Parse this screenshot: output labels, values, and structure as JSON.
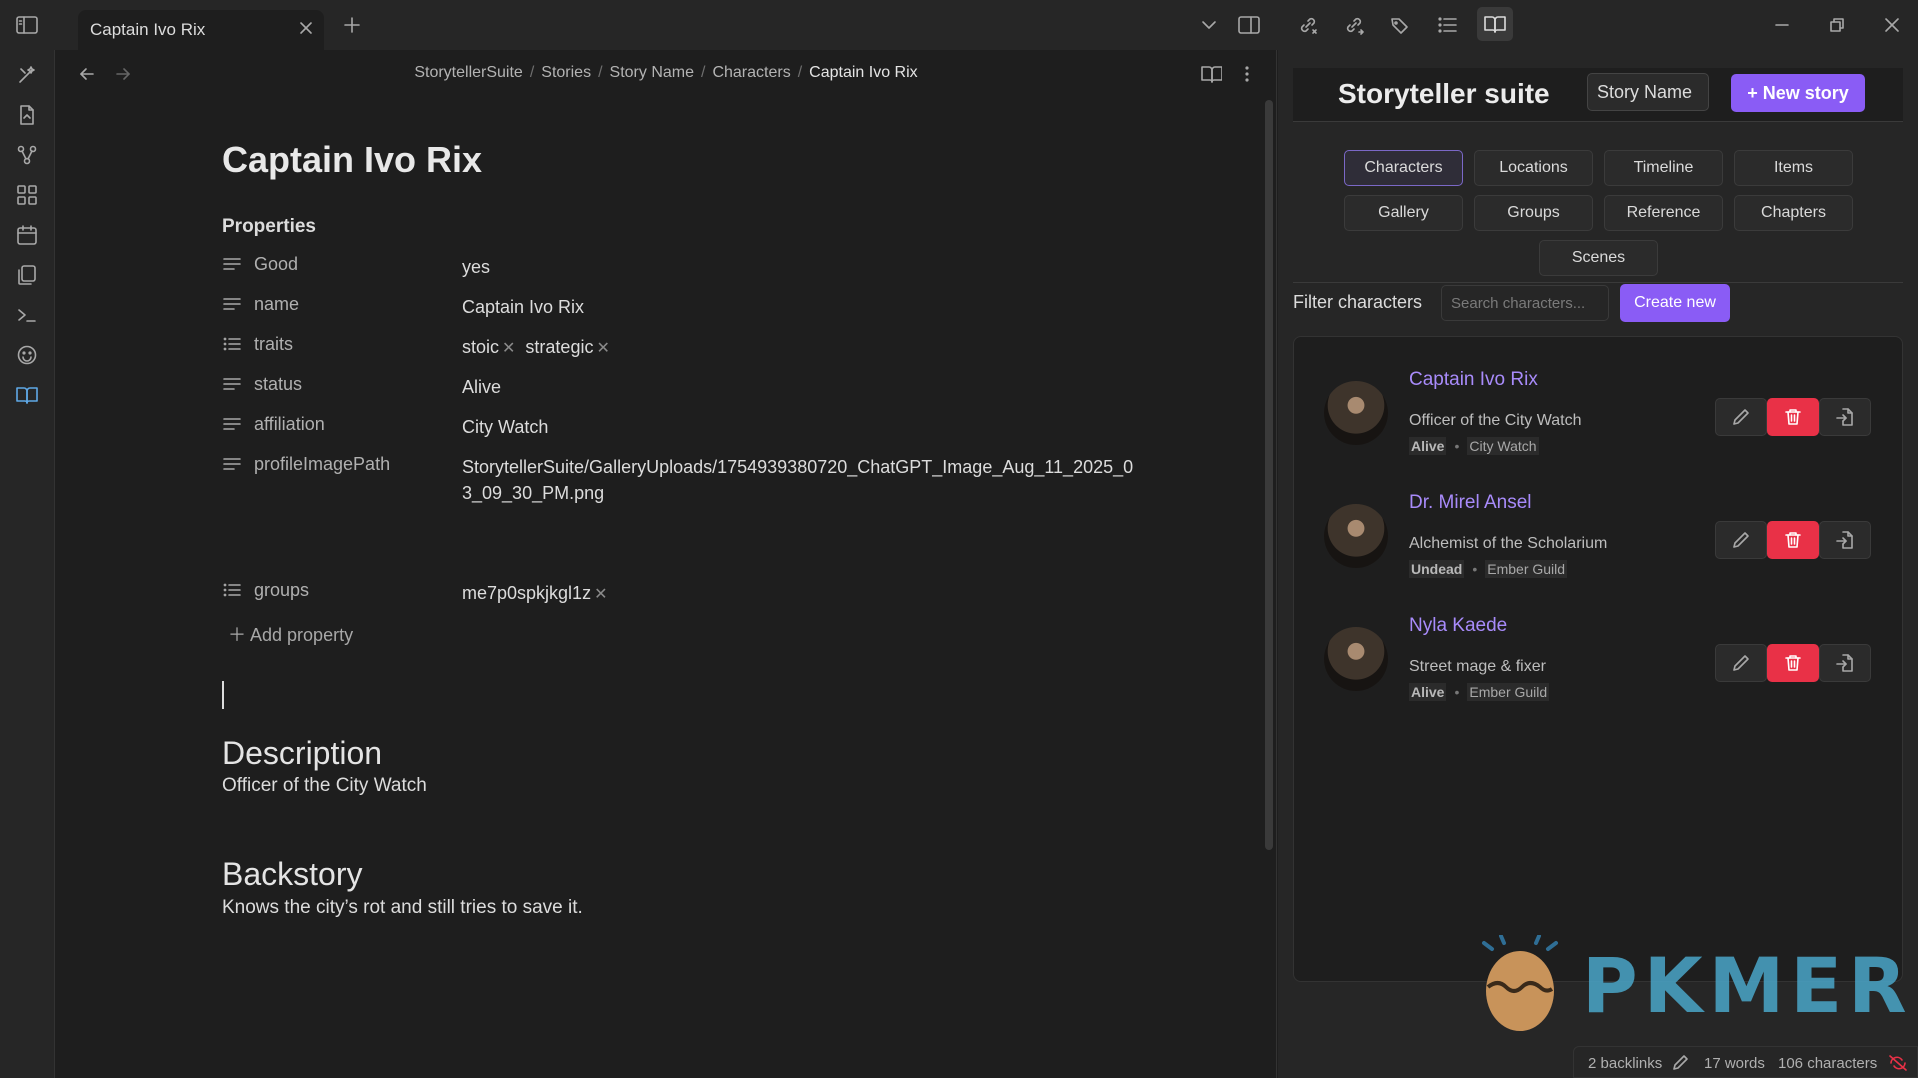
{
  "tab": {
    "title": "Captain Ivo Rix"
  },
  "breadcrumb": {
    "items": [
      "StorytellerSuite",
      "Stories",
      "Story Name",
      "Characters"
    ],
    "current": "Captain Ivo Rix"
  },
  "note": {
    "title": "Captain Ivo Rix",
    "properties_heading": "Properties",
    "properties": [
      {
        "key": "Good",
        "icon": "text-icon",
        "value": "yes"
      },
      {
        "key": "name",
        "icon": "text-icon",
        "value": "Captain Ivo Rix"
      },
      {
        "key": "traits",
        "icon": "list-icon",
        "values": [
          "stoic",
          "strategic"
        ]
      },
      {
        "key": "status",
        "icon": "text-icon",
        "value": "Alive"
      },
      {
        "key": "affiliation",
        "icon": "text-icon",
        "value": "City Watch"
      },
      {
        "key": "profileImagePath",
        "icon": "text-icon",
        "value": "StorytellerSuite/GalleryUploads/1754939380720_ChatGPT_Image_Aug_11_2025_03_09_30_PM.png"
      },
      {
        "key": "groups",
        "icon": "list-icon",
        "values": [
          "me7p0spkjkgl1z"
        ]
      }
    ],
    "add_property": "Add property",
    "description_heading": "Description",
    "description": "Officer of the City Watch",
    "backstory_heading": "Backstory",
    "backstory": "Knows the city’s rot and still tries to save it."
  },
  "sidebar": {
    "title": "Storyteller suite",
    "story_select": "Story Name",
    "new_story": "+ New story",
    "tabs": [
      "Characters",
      "Locations",
      "Timeline",
      "Items",
      "Gallery",
      "Groups",
      "Reference",
      "Chapters",
      "Scenes"
    ],
    "active_tab": "Characters",
    "filter_label": "Filter characters",
    "search_placeholder": "Search characters...",
    "create_new": "Create new",
    "characters": [
      {
        "name": "Captain Ivo Rix",
        "role": "Officer of the City Watch",
        "status": "Alive",
        "group": "City Watch"
      },
      {
        "name": "Dr. Mirel Ansel",
        "role": "Alchemist of the Scholarium",
        "status": "Undead",
        "group": "Ember Guild"
      },
      {
        "name": "Nyla Kaede",
        "role": "Street mage & fixer",
        "status": "Alive",
        "group": "Ember Guild"
      }
    ]
  },
  "statusbar": {
    "backlinks": "2 backlinks",
    "words": "17 words",
    "characters": "106 characters"
  },
  "watermark": {
    "text": "PKMER"
  },
  "colors": {
    "accent": "#8a5cf5",
    "delete": "#e93147",
    "link": "#a88bfa"
  }
}
